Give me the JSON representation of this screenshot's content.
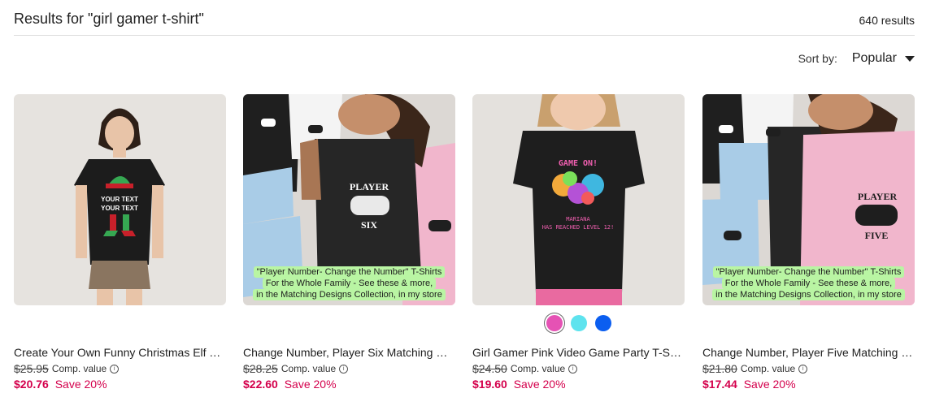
{
  "search": {
    "results_title": "Results for \"girl gamer t-shirt\"",
    "results_count": "640 results"
  },
  "sort": {
    "label": "Sort by:",
    "value": "Popular"
  },
  "products": [
    {
      "title": "Create Your Own Funny Christmas Elf Tri...",
      "comp_price": "$25.95",
      "comp_label": "Comp. value",
      "price": "$20.76",
      "save": "Save 20%",
      "shirt_text": [
        "YOUR TEXT",
        "YOUR TEXT"
      ]
    },
    {
      "title": "Change Number, Player Six Matching Gir...",
      "comp_price": "$28.25",
      "comp_label": "Comp. value",
      "price": "$22.60",
      "save": "Save 20%",
      "shirt_text": [
        "PLAYER",
        "SIX"
      ],
      "promo": [
        "\"Player Number- Change the Number\" T-Shirts",
        "For the Whole Family -  See these & more,",
        "in the Matching Designs Collection, in my store"
      ]
    },
    {
      "title": "Girl Gamer Pink Video Game Party T-Shirt",
      "comp_price": "$24.50",
      "comp_label": "Comp. value",
      "price": "$19.60",
      "save": "Save 20%",
      "shirt_text": [
        "GAME ON!",
        "MARIANA",
        "HAS REACHED LEVEL 12!"
      ],
      "swatches": [
        "#e552b4",
        "#5ee3ee",
        "#0b5ef0"
      ]
    },
    {
      "title": "Change Number, Player Five Matching Gi...",
      "comp_price": "$21.80",
      "comp_label": "Comp. value",
      "price": "$17.44",
      "save": "Save 20%",
      "shirt_text": [
        "PLAYER",
        "FIVE"
      ],
      "promo": [
        "\"Player Number- Change the Number\" T-Shirts",
        "For the Whole Family -  See these & more,",
        "in the Matching Designs Collection, in my store"
      ]
    }
  ],
  "colors": {
    "sale_price": "#d4004c",
    "promo_bg": "#b9f5a3"
  }
}
